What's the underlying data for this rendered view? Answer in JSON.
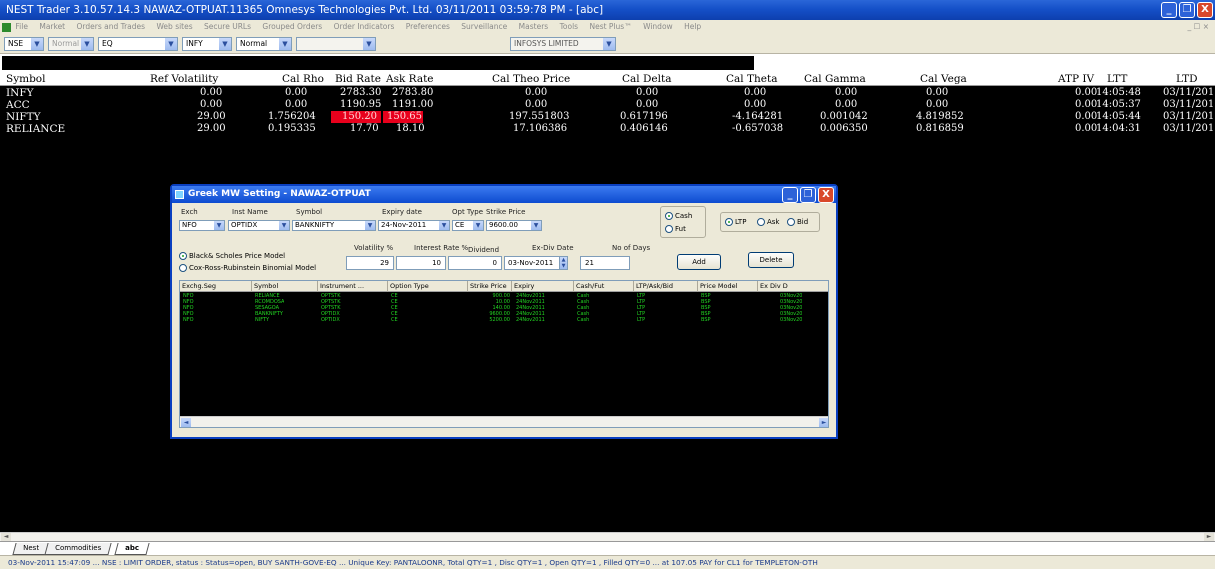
{
  "title_bar": {
    "title": "NEST Trader 3.10.57.14.3 NAWAZ-OTPUAT.11365 Omnesys Technologies Pvt. Ltd.  03/11/2011  03:59:78 PM - [abc]",
    "minimize": "_",
    "restore": "❐",
    "close": "X"
  },
  "menu_bar": {
    "items": [
      "File",
      "Market",
      "Orders and Trades",
      "Web sites",
      "Secure URLs",
      "Grouped Orders",
      "Order Indicators",
      "Preferences",
      "Surveillance",
      "Masters",
      "Tools",
      "Nest Plus™",
      "Window",
      "Help"
    ],
    "mdi_controls": "_ ☐ ×"
  },
  "toolbar": {
    "exchange": "NSE",
    "series_type": "Normal",
    "segment": "EQ",
    "symbol": "INFY",
    "market_type": "Normal",
    "blank": "",
    "company": "INFOSYS LIMITED"
  },
  "market_watch": {
    "headers": {
      "symbol": "Symbol",
      "ref_volatility": "Ref Volatility",
      "cal_rho": "Cal Rho",
      "bid_rate": "Bid Rate",
      "ask_rate": "Ask Rate",
      "cal_theo_price": "Cal Theo Price",
      "cal_delta": "Cal Delta",
      "cal_theta": "Cal Theta",
      "cal_gamma": "Cal Gamma",
      "cal_vega": "Cal Vega",
      "atp_iv": "ATP IV",
      "ltt": "LTT",
      "ltd": "LTD"
    },
    "rows": [
      {
        "symbol": "INFY",
        "ref_volatility": "0.00",
        "cal_rho": "0.00",
        "bid_rate": "2783.30",
        "ask_rate": "2783.80",
        "cal_theo_price": "0.00",
        "cal_delta": "0.00",
        "cal_theta": "0.00",
        "cal_gamma": "0.00",
        "cal_vega": "0.00",
        "atp_iv": "0.00",
        "ltt": "14:05:48",
        "ltd": "03/11/201"
      },
      {
        "symbol": "ACC",
        "ref_volatility": "0.00",
        "cal_rho": "0.00",
        "bid_rate": "1190.95",
        "ask_rate": "1191.00",
        "cal_theo_price": "0.00",
        "cal_delta": "0.00",
        "cal_theta": "0.00",
        "cal_gamma": "0.00",
        "cal_vega": "0.00",
        "atp_iv": "0.00",
        "ltt": "14:05:37",
        "ltd": "03/11/201"
      },
      {
        "symbol": "NIFTY",
        "ref_volatility": "29.00",
        "cal_rho": "1.756204",
        "bid_rate": "150.20",
        "ask_rate": "150.65",
        "cal_theo_price": "197.551803",
        "cal_delta": "0.617196",
        "cal_theta": "-4.164281",
        "cal_gamma": "0.001042",
        "cal_vega": "4.819852",
        "atp_iv": "0.00",
        "ltt": "14:05:44",
        "ltd": "03/11/201"
      },
      {
        "symbol": "RELIANCE",
        "ref_volatility": "29.00",
        "cal_rho": "0.195335",
        "bid_rate": "17.70",
        "ask_rate": "18.10",
        "cal_theo_price": "17.106386",
        "cal_delta": "0.406146",
        "cal_theta": "-0.657038",
        "cal_gamma": "0.006350",
        "cal_vega": "0.816859",
        "atp_iv": "0.00",
        "ltt": "14:04:31",
        "ltd": "03/11/201"
      }
    ],
    "highlight_color": "#e8001c"
  },
  "dialog": {
    "title": "Greek MW Setting - NAWAZ-OTPUAT",
    "labels": {
      "exch": "Exch",
      "inst_name": "Inst Name",
      "symbol": "Symbol",
      "expiry_date": "Expiry date",
      "opt_type": "Opt Type",
      "strike_price": "Strike Price",
      "volatility": "Volatility %",
      "interest_rate": "Interest Rate %",
      "dividend": "Dividend",
      "ex_div_date": "Ex-Div Date",
      "no_of_days": "No of Days"
    },
    "values": {
      "exch": "NFO",
      "inst_name": "OPTIDX",
      "symbol": "BANKNIFTY",
      "expiry_date": "24-Nov-2011",
      "opt_type": "CE",
      "strike_price": "9600.00",
      "volatility": "29",
      "interest_rate": "10",
      "dividend": "0",
      "ex_div_date": "03-Nov-2011",
      "no_of_days": "21"
    },
    "radios": {
      "cash": "Cash",
      "fut": "Fut",
      "ltp": "LTP",
      "ask": "Ask",
      "bid": "Bid",
      "black_scholes": "Black& Scholes Price Model",
      "cox_ross": "Cox-Ross-Rubinstein Binomial Model"
    },
    "buttons": {
      "add": "Add",
      "delete": "Delete"
    },
    "grid_headers": [
      "Exchg.Seg",
      "Symbol",
      "Instrument ...",
      "Option Type",
      "Strike Price",
      "Expiry",
      "Cash/Fut",
      "LTP/Ask/Bid",
      "Price Model",
      "Ex Div D"
    ],
    "grid_rows": [
      [
        "NFO",
        "RELIANCE",
        "OPTSTK",
        "CE",
        "900.00",
        "24Nov2011",
        "Cash",
        "LTP",
        "BSP",
        "03Nov20"
      ],
      [
        "NFO",
        "RCOMDOSA",
        "OPTSTK",
        "CE",
        "10.00",
        "24Nov2011",
        "Cash",
        "LTP",
        "BSP",
        "03Nov20"
      ],
      [
        "NFO",
        "SESAGOA",
        "OPTSTK",
        "CE",
        "140.00",
        "24Nov2011",
        "Cash",
        "LTP",
        "BSP",
        "03Nov20"
      ],
      [
        "NFO",
        "BANKNIFTY",
        "OPTIDX",
        "CE",
        "9600.00",
        "24Nov2011",
        "Cash",
        "LTP",
        "BSP",
        "03Nov20"
      ],
      [
        "NFO",
        "NIFTY",
        "OPTIDX",
        "CE",
        "5200.00",
        "24Nov2011",
        "Cash",
        "LTP",
        "BSP",
        "03Nov20"
      ]
    ]
  },
  "tabs": [
    "Nest",
    "Commodities",
    "abc"
  ],
  "status_bar": "03-Nov-2011 15:47:09 ...  NSE : LIMIT ORDER, status : Status=open, BUY SANTH-GOVE-EQ ...  Unique Key: PANTALOONR, Total QTY=1 , Disc QTY=1 , Open QTY=1 , Filled QTY=0 ... at 107.05 PAY for CL1 for TEMPLETON-OTH"
}
